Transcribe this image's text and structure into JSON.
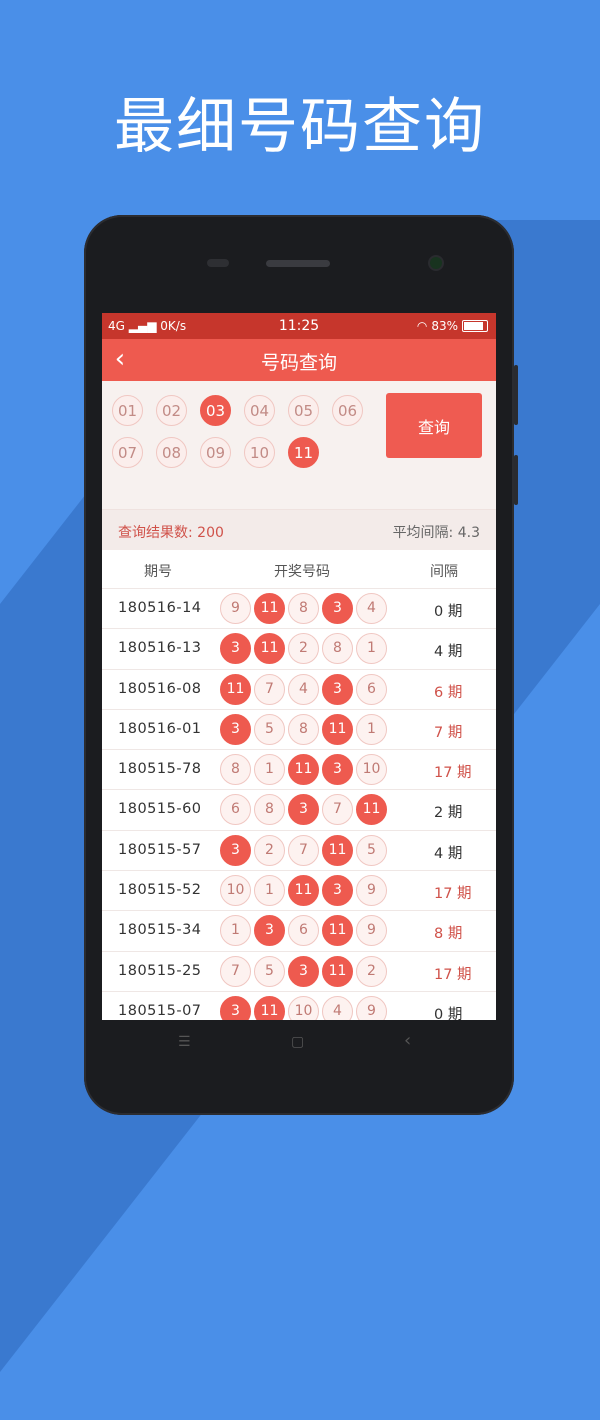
{
  "headline": "最细号码查询",
  "status": {
    "network": "4G",
    "speed": "0K/s",
    "time": "11:25",
    "battery": "83%"
  },
  "appbar": {
    "back_icon": "‹",
    "title": "号码查询"
  },
  "picker": {
    "numbers": [
      "01",
      "02",
      "03",
      "04",
      "05",
      "06",
      "07",
      "08",
      "09",
      "10",
      "11"
    ],
    "selected": [
      "03",
      "11"
    ],
    "query_button": "查询"
  },
  "summary": {
    "count_label": "查询结果数: 200",
    "avg_label": "平均间隔: 4.3"
  },
  "table": {
    "headers": {
      "period": "期号",
      "numbers": "开奖号码",
      "gap": "间隔"
    },
    "rows": [
      {
        "period": "180516-14",
        "balls": [
          "9",
          "11",
          "8",
          "3",
          "4"
        ],
        "gap": "0 期",
        "hot": false
      },
      {
        "period": "180516-13",
        "balls": [
          "3",
          "11",
          "2",
          "8",
          "1"
        ],
        "gap": "4 期",
        "hot": false
      },
      {
        "period": "180516-08",
        "balls": [
          "11",
          "7",
          "4",
          "3",
          "6"
        ],
        "gap": "6 期",
        "hot": true
      },
      {
        "period": "180516-01",
        "balls": [
          "3",
          "5",
          "8",
          "11",
          "1"
        ],
        "gap": "7 期",
        "hot": true
      },
      {
        "period": "180515-78",
        "balls": [
          "8",
          "1",
          "11",
          "3",
          "10"
        ],
        "gap": "17 期",
        "hot": true
      },
      {
        "period": "180515-60",
        "balls": [
          "6",
          "8",
          "3",
          "7",
          "11"
        ],
        "gap": "2 期",
        "hot": false
      },
      {
        "period": "180515-57",
        "balls": [
          "3",
          "2",
          "7",
          "11",
          "5"
        ],
        "gap": "4 期",
        "hot": false
      },
      {
        "period": "180515-52",
        "balls": [
          "10",
          "1",
          "11",
          "3",
          "9"
        ],
        "gap": "17 期",
        "hot": true
      },
      {
        "period": "180515-34",
        "balls": [
          "1",
          "3",
          "6",
          "11",
          "9"
        ],
        "gap": "8 期",
        "hot": true
      },
      {
        "period": "180515-25",
        "balls": [
          "7",
          "5",
          "3",
          "11",
          "2"
        ],
        "gap": "17 期",
        "hot": true
      },
      {
        "period": "180515-07",
        "balls": [
          "3",
          "11",
          "10",
          "4",
          "9"
        ],
        "gap": "0 期",
        "hot": false
      }
    ]
  },
  "navbar": {
    "menu_icon": "☰",
    "home_icon": "▢",
    "back_icon": "‹"
  },
  "colors": {
    "accent": "#ee5a4f",
    "status_bar": "#c6362c",
    "background": "#4a8fe8"
  }
}
